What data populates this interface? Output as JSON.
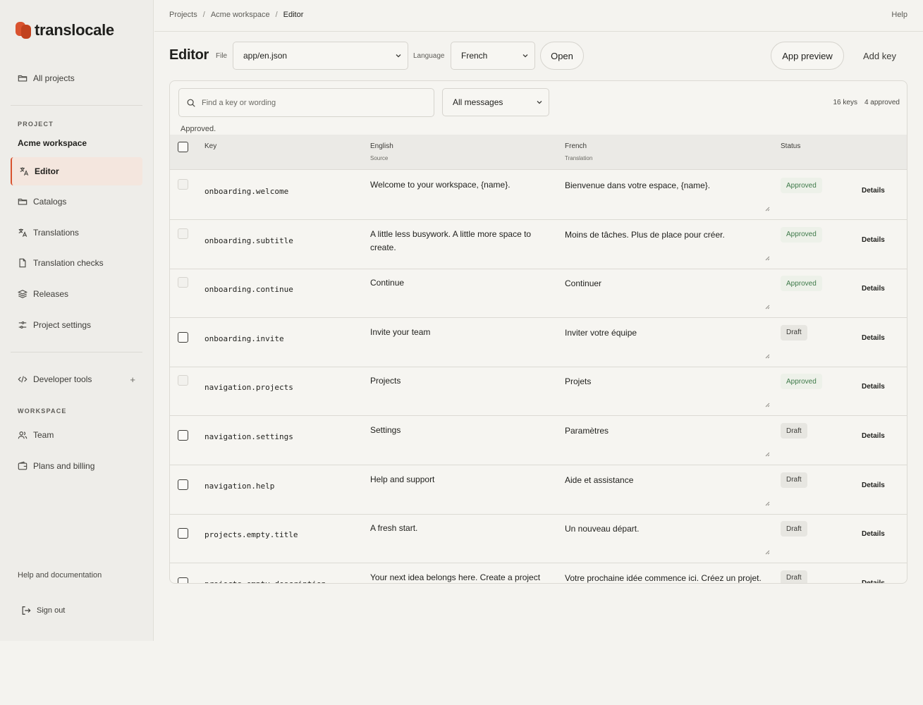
{
  "app": {
    "name": "translocale"
  },
  "sidebar": {
    "all_projects": "All projects",
    "project_label": "PROJECT",
    "project_name": "Acme workspace",
    "items": [
      {
        "label": "Editor",
        "icon": "translate-icon"
      },
      {
        "label": "Catalogs",
        "icon": "folder-icon"
      },
      {
        "label": "Translations",
        "icon": "translate-icon"
      },
      {
        "label": "Translation checks",
        "icon": "file-icon"
      },
      {
        "label": "Releases",
        "icon": "layers-icon"
      },
      {
        "label": "Project settings",
        "icon": "sliders-icon"
      }
    ],
    "developer_tools": "Developer tools",
    "developer_tools_plus": "+",
    "workspace_label": "WORKSPACE",
    "workspace_items": [
      {
        "label": "Team",
        "icon": "users-icon"
      },
      {
        "label": "Plans and billing",
        "icon": "wallet-icon"
      }
    ],
    "help_docs": "Help and documentation",
    "sign_out": "Sign out"
  },
  "topbar": {
    "breadcrumb": [
      "Projects",
      "Acme workspace",
      "Editor"
    ],
    "separator": "/",
    "help": "Help"
  },
  "toolbar": {
    "title": "Editor",
    "file_label": "File",
    "file_value": "app/en.json",
    "language_label": "Language",
    "language_value": "French",
    "open": "Open",
    "app_preview": "App preview",
    "add_key": "Add key"
  },
  "panel": {
    "search_placeholder": "Find a key or wording",
    "filter_value": "All messages",
    "keys_count": "16 keys",
    "approved_count": "4 approved",
    "status_note": "Approved."
  },
  "table": {
    "headers": {
      "key": "Key",
      "source": "English",
      "source_sub": "Source",
      "target": "French",
      "target_sub": "Translation",
      "status": "Status"
    },
    "rows": [
      {
        "key": "onboarding.welcome",
        "source": "Welcome to your workspace, {name}.",
        "target": "Bienvenue dans votre espace, {name}.",
        "status": "Approved",
        "action": "Details"
      },
      {
        "key": "onboarding.subtitle",
        "source": "A little less busywork. A little more space to create.",
        "target": "Moins de tâches. Plus de place pour créer.",
        "status": "Approved",
        "action": "Details"
      },
      {
        "key": "onboarding.continue",
        "source": "Continue",
        "target": "Continuer",
        "status": "Approved",
        "action": "Details"
      },
      {
        "key": "onboarding.invite",
        "source": "Invite your team",
        "target": "Inviter votre équipe",
        "status": "Draft",
        "action": "Details"
      },
      {
        "key": "navigation.projects",
        "source": "Projects",
        "target": "Projets",
        "status": "Approved",
        "action": "Details"
      },
      {
        "key": "navigation.settings",
        "source": "Settings",
        "target": "Paramètres",
        "status": "Draft",
        "action": "Details"
      },
      {
        "key": "navigation.help",
        "source": "Help and support",
        "target": "Aide et assistance",
        "status": "Draft",
        "action": "Details"
      },
      {
        "key": "projects.empty.title",
        "source": "A fresh start.",
        "target": "Un nouveau départ.",
        "status": "Draft",
        "action": "Details"
      },
      {
        "key": "projects.empty.description",
        "source": "Your next idea belongs here. Create a project",
        "target": "Votre prochaine idée commence ici. Créez un projet.",
        "status": "Draft",
        "action": "Details"
      }
    ]
  },
  "colors": {
    "accent": "#d9532f",
    "approved_text": "#3f7a4a",
    "background": "#f4f3ef"
  }
}
